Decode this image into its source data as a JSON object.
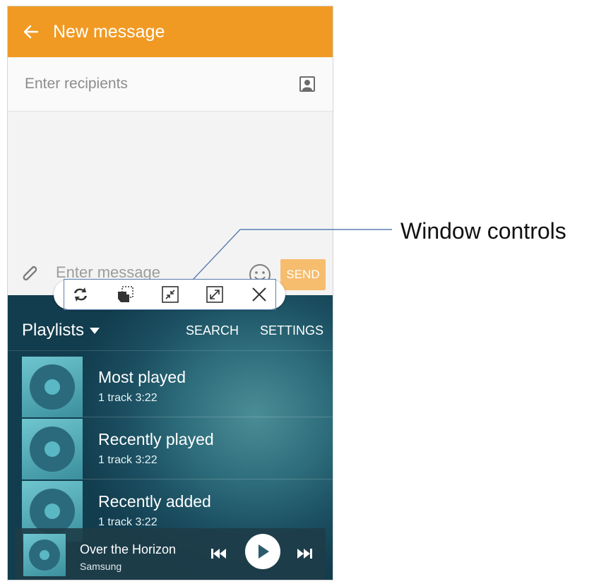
{
  "app_bar": {
    "title": "New message"
  },
  "recipients": {
    "placeholder": "Enter recipients"
  },
  "compose": {
    "placeholder": "Enter message",
    "send_label": "SEND"
  },
  "music": {
    "header": {
      "playlists_label": "Playlists",
      "search_label": "SEARCH",
      "settings_label": "SETTINGS"
    },
    "playlists": [
      {
        "title": "Most played",
        "subtitle": "1 track   3:22"
      },
      {
        "title": "Recently played",
        "subtitle": "1 track   3:22"
      },
      {
        "title": "Recently added",
        "subtitle": "1 track   3:22"
      }
    ],
    "now_playing": {
      "title": "Over the Horizon",
      "artist": "Samsung"
    }
  },
  "window_controls": {
    "icons": [
      "switch-windows-icon",
      "drag-and-drop-icon",
      "minimize-icon",
      "maximize-icon",
      "close-icon"
    ]
  },
  "annotation": {
    "label": "Window controls"
  },
  "colors": {
    "app_bar": "#f09a24",
    "send_button": "#f6bd6f",
    "callout_line": "#5a7fb0"
  }
}
